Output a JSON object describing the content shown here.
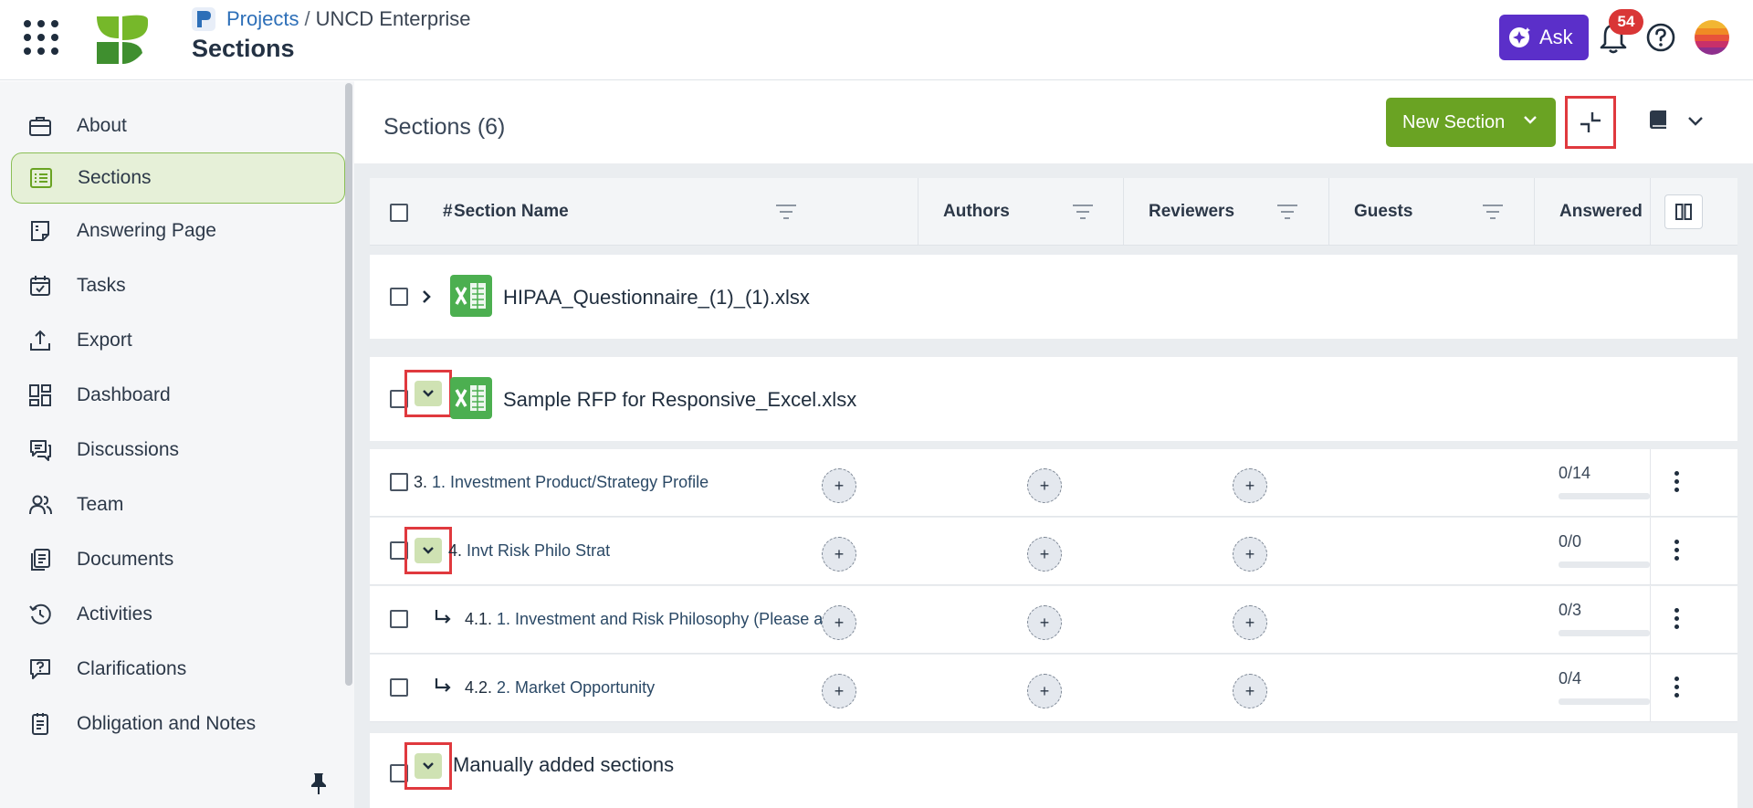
{
  "header": {
    "breadcrumb_projects": "Projects",
    "breadcrumb_separator": "/",
    "breadcrumb_current": "UNCD Enterprise",
    "page_title": "Sections",
    "ask_label": "Ask",
    "notification_count": "54"
  },
  "sidebar": {
    "items": [
      {
        "label": "About",
        "icon": "briefcase-icon"
      },
      {
        "label": "Sections",
        "icon": "list-icon"
      },
      {
        "label": "Answering Page",
        "icon": "page-icon"
      },
      {
        "label": "Tasks",
        "icon": "calendar-check-icon"
      },
      {
        "label": "Export",
        "icon": "upload-icon"
      },
      {
        "label": "Dashboard",
        "icon": "dashboard-icon"
      },
      {
        "label": "Discussions",
        "icon": "chat-icon"
      },
      {
        "label": "Team",
        "icon": "team-icon"
      },
      {
        "label": "Documents",
        "icon": "documents-icon"
      },
      {
        "label": "Activities",
        "icon": "history-icon"
      },
      {
        "label": "Clarifications",
        "icon": "question-chat-icon"
      },
      {
        "label": "Obligation and Notes",
        "icon": "notes-icon"
      }
    ],
    "active_index": 1
  },
  "main": {
    "title": "Sections (6)",
    "new_section_label": "New Section"
  },
  "table": {
    "columns": {
      "hash": "#",
      "section_name": "Section Name",
      "authors": "Authors",
      "reviewers": "Reviewers",
      "guests": "Guests",
      "answered": "Answered"
    },
    "groups": {
      "hipaa": "HIPAA_Questionnaire_(1)_(1).xlsx",
      "sample_rfp": "Sample RFP for Responsive_Excel.xlsx",
      "manual": "Manually added sections"
    },
    "rows": [
      {
        "num": "3.",
        "name": "1. Investment Product/Strategy Profile",
        "answered": "0/14"
      },
      {
        "num": "4.",
        "name": "Invt Risk Philo Strat",
        "answered": "0/0"
      },
      {
        "num": "4.1.",
        "name": "1. Investment and Risk Philosophy (Please at...",
        "answered": "0/3"
      },
      {
        "num": "4.2.",
        "name": "2. Market Opportunity",
        "answered": "0/4"
      }
    ],
    "plus_symbol": "+"
  },
  "colors": {
    "accent_green": "#6aa323",
    "ask_purple": "#5b2fc9",
    "badge_red": "#d93636",
    "highlight_red": "#e0393e",
    "link_blue": "#2d6fb8"
  }
}
